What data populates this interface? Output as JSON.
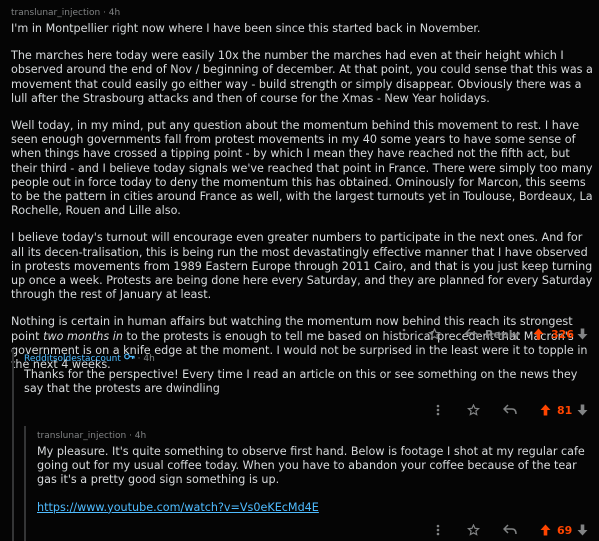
{
  "comments": [
    {
      "author": "translunar_injection",
      "time": "· 4h",
      "paragraphs": [
        "I'm in Montpellier right now where I have been since this started back in November.",
        "The marches here today were easily 10x the number the marches had even at their height which I observed around the end of Nov / beginning of december. At that point, you could sense that this was a movement that could easily go either way - build strength or simply disappear. Obviously there was a lull after the Strasbourg attacks and then of course for the Xmas - New Year holidays.",
        "Well today, in my mind, put any question about the momentum behind this movement to rest. I have seen enough governments fall from protest movements in my 40 some years to have some sense of when things have crossed a tipping point - by which I mean they have reached not the fifth act, but their third - and I believe today signals we've reached that point in France. There were simply too many people out in force today to deny the momentum this has obtained. Ominously for Marcon, this seems to be the pattern in cities around France as well, with the largest turnouts yet in Toulouse, Bordeaux, La Rochelle, Rouen and Lille also.",
        "I believe today's turnout will encourage even greater numbers to participate in the next ones. And for all its decen-tralisation, this is being run the most devastatingly effective manner that I have observed in protests movements from 1989 Eastern Europe through 2011 Cairo, and that is you just keep turning up once a week. Protests are being done here every Saturday, and they are planned for every Saturday through the rest of January at least."
      ],
      "last_paragraph": {
        "before": "Nothing is certain in human affairs but watching the momentum now behind this reach its strongest point ",
        "emphasis": "two months in",
        "after": " to the protests is enough to tell me based on historical precedent that Macron's government is on a knife edge at the moment. I would not be surprised in the least were it to topple in the next 4 weeks."
      },
      "reply_label": "Reply",
      "votes": "326"
    },
    {
      "author": "Redditsoldestaccount",
      "time": "· 4h",
      "text": "Thanks for the perspective! Every time I read an article on this or see something on the news they say that the protests are dwindling",
      "votes": "81"
    },
    {
      "author": "translunar_injection",
      "time": "· 4h",
      "text_before": "My pleasure. It's quite something to observe first hand. Below is footage I shot at my regular cafe going out for my usual coffee today. When you have to abandon your coffee ",
      "text_bold": "because of the tear gas",
      "text_after": " it's a pretty good sign something is up.",
      "link": "https://www.youtube.com/watch?v=Vs0eKEcMd4E",
      "votes": "69"
    }
  ],
  "icons": {
    "more": "more-options-icon",
    "award": "award-icon",
    "share": "share-icon",
    "upvote": "upvote-arrow-icon",
    "downvote": "downvote-arrow-icon",
    "badge": "key-badge-icon"
  },
  "colors": {
    "upvote": "#ff4500",
    "link": "#4fbcff",
    "background": "#050505",
    "text": "#d7dadc"
  }
}
